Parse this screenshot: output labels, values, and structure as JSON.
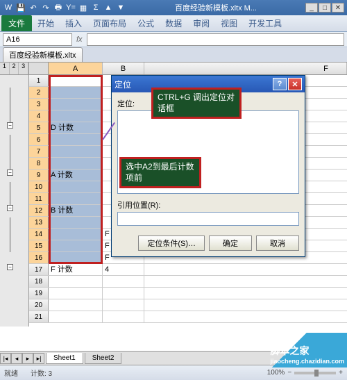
{
  "titlebar": {
    "title": "百度经验新模板.xltx M...",
    "qat_icons": [
      "W",
      "save",
      "undo",
      "redo",
      "print",
      "Y=",
      "grid",
      "Σ",
      "up",
      "dn",
      "|"
    ]
  },
  "window_controls": {
    "min": "_",
    "max": "□",
    "close": "✕"
  },
  "ribbon": {
    "file": "文件",
    "tabs": [
      "开始",
      "插入",
      "页面布局",
      "公式",
      "数据",
      "审阅",
      "视图",
      "开发工具",
      "|"
    ]
  },
  "namebox": "A16",
  "fx": "fx",
  "doc_tab": "百度经验新模板.xltx",
  "outline_levels": [
    "1",
    "2",
    "3"
  ],
  "columns": [
    "A",
    "B",
    "F"
  ],
  "rows_data": [
    {
      "n": 1,
      "a": "",
      "b": ""
    },
    {
      "n": 2,
      "a": "",
      "b": ""
    },
    {
      "n": 3,
      "a": "",
      "b": ""
    },
    {
      "n": 4,
      "a": "",
      "b": ""
    },
    {
      "n": 5,
      "a": "D 计数",
      "b": ""
    },
    {
      "n": 6,
      "a": "",
      "b": ""
    },
    {
      "n": 7,
      "a": "",
      "b": ""
    },
    {
      "n": 8,
      "a": "",
      "b": ""
    },
    {
      "n": 9,
      "a": "A 计数",
      "b": ""
    },
    {
      "n": 10,
      "a": "",
      "b": ""
    },
    {
      "n": 11,
      "a": "",
      "b": ""
    },
    {
      "n": 12,
      "a": "B 计数",
      "b": ""
    },
    {
      "n": 13,
      "a": "",
      "b": ""
    },
    {
      "n": 14,
      "a": "",
      "b": "F"
    },
    {
      "n": 15,
      "a": "",
      "b": "F"
    },
    {
      "n": 16,
      "a": "",
      "b": "F"
    },
    {
      "n": 17,
      "a": "F 计数",
      "b": "4"
    },
    {
      "n": 18,
      "a": "",
      "b": ""
    },
    {
      "n": 19,
      "a": "",
      "b": ""
    },
    {
      "n": 20,
      "a": "",
      "b": ""
    },
    {
      "n": 21,
      "a": "",
      "b": ""
    }
  ],
  "dialog": {
    "title": "定位",
    "label": "定位:",
    "ref_label": "引用位置(R):",
    "ref_value": "",
    "buttons": {
      "special": "定位条件(S)…",
      "ok": "确定",
      "cancel": "取消"
    }
  },
  "callouts": {
    "top": "CTRL+G 调出定位对话框",
    "mid": "选中A2到最后计数项前"
  },
  "sheets": {
    "nav": [
      "|◂",
      "◂",
      "▸",
      "▸|"
    ],
    "tabs": [
      "Sheet1",
      "Sheet2"
    ]
  },
  "statusbar": {
    "ready": "就绪",
    "count": "计数: 3",
    "zoom": "100%",
    "zoom_minus": "−",
    "zoom_plus": "+"
  },
  "watermark": {
    "main": "脚本之家",
    "sub": "jiaocheng.chazidian.com"
  }
}
